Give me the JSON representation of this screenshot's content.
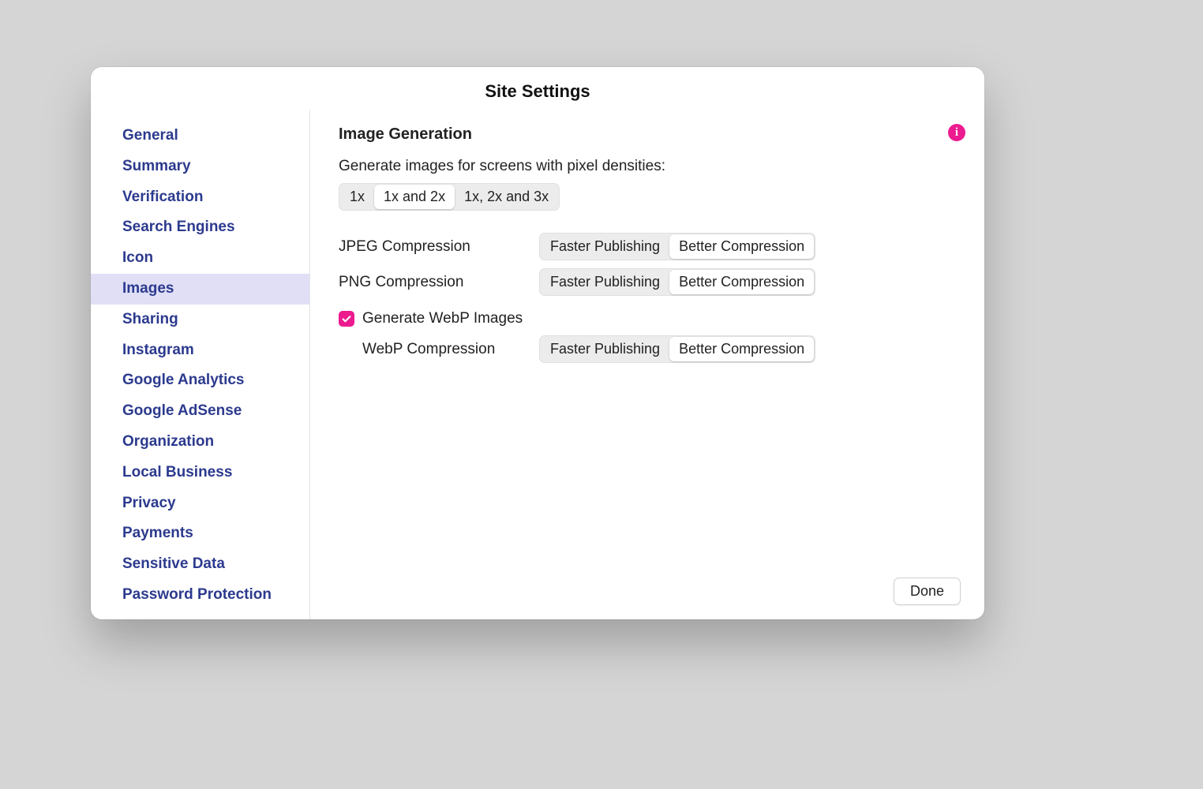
{
  "window": {
    "title": "Site Settings"
  },
  "sidebar": {
    "items": [
      {
        "label": "General",
        "active": false
      },
      {
        "label": "Summary",
        "active": false
      },
      {
        "label": "Verification",
        "active": false
      },
      {
        "label": "Search Engines",
        "active": false
      },
      {
        "label": "Icon",
        "active": false
      },
      {
        "label": "Images",
        "active": true
      },
      {
        "label": "Sharing",
        "active": false
      },
      {
        "label": "Instagram",
        "active": false
      },
      {
        "label": "Google Analytics",
        "active": false
      },
      {
        "label": "Google AdSense",
        "active": false
      },
      {
        "label": "Organization",
        "active": false
      },
      {
        "label": "Local Business",
        "active": false
      },
      {
        "label": "Privacy",
        "active": false
      },
      {
        "label": "Payments",
        "active": false
      },
      {
        "label": "Sensitive Data",
        "active": false
      },
      {
        "label": "Password Protection",
        "active": false
      }
    ]
  },
  "content": {
    "section_title": "Image Generation",
    "density_label": "Generate images for screens with pixel densities:",
    "density_options": [
      {
        "label": "1x",
        "selected": false
      },
      {
        "label": "1x and 2x",
        "selected": true
      },
      {
        "label": "1x, 2x and 3x",
        "selected": false
      }
    ],
    "jpeg_label": "JPEG Compression",
    "jpeg_options": [
      {
        "label": "Faster Publishing",
        "selected": false
      },
      {
        "label": "Better Compression",
        "selected": true
      }
    ],
    "png_label": "PNG Compression",
    "png_options": [
      {
        "label": "Faster Publishing",
        "selected": false
      },
      {
        "label": "Better Compression",
        "selected": true
      }
    ],
    "webp_checkbox_label": "Generate WebP Images",
    "webp_checked": true,
    "webp_label": "WebP Compression",
    "webp_options": [
      {
        "label": "Faster Publishing",
        "selected": false
      },
      {
        "label": "Better Compression",
        "selected": true
      }
    ]
  },
  "footer": {
    "done_label": "Done"
  }
}
